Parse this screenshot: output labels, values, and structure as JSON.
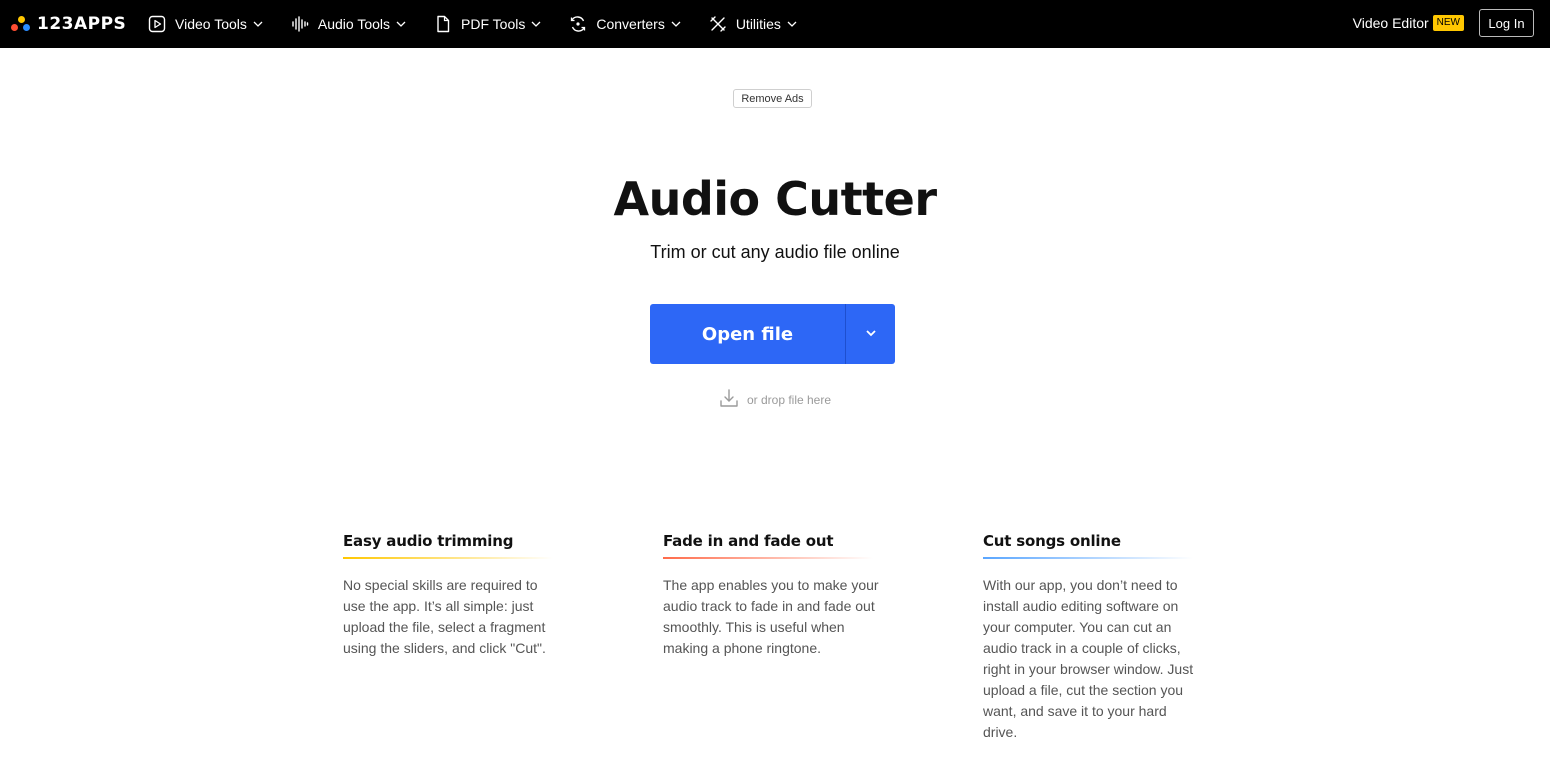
{
  "header": {
    "logo_text": "123APPS",
    "nav": [
      {
        "label": "Video Tools",
        "icon": "play-icon"
      },
      {
        "label": "Audio Tools",
        "icon": "waveform-icon"
      },
      {
        "label": "PDF Tools",
        "icon": "document-icon"
      },
      {
        "label": "Converters",
        "icon": "refresh-icon"
      },
      {
        "label": "Utilities",
        "icon": "tools-icon"
      }
    ],
    "video_editor_label": "Video Editor",
    "new_badge": "NEW",
    "login_label": "Log In"
  },
  "remove_ads_label": "Remove Ads",
  "hero": {
    "title": "Audio Cutter",
    "subtitle": "Trim or cut any audio file online",
    "open_file_label": "Open file",
    "drop_hint": "or drop file here"
  },
  "features": [
    {
      "title": "Easy audio trimming",
      "text": "No special skills are required to use the app. It’s all simple: just upload the file, select a fragment using the sliders, and click \"Cut\".",
      "accent": "#ffc700"
    },
    {
      "title": "Fade in and fade out",
      "text": "The app enables you to make your audio track to fade in and fade out smoothly. This is useful when making a phone ringtone.",
      "accent": "#ff6b4a"
    },
    {
      "title": "Cut songs online",
      "text": "With our app, you don’t need to install audio editing software on your computer. You can cut an audio track in a couple of clicks, right in your browser window. Just upload a file, cut the section you want, and save it to your hard drive.",
      "accent": "#5aa6ff"
    }
  ],
  "colors": {
    "header_bg": "#000000",
    "primary_button": "#2d67f6",
    "badge": "#ffc700"
  }
}
